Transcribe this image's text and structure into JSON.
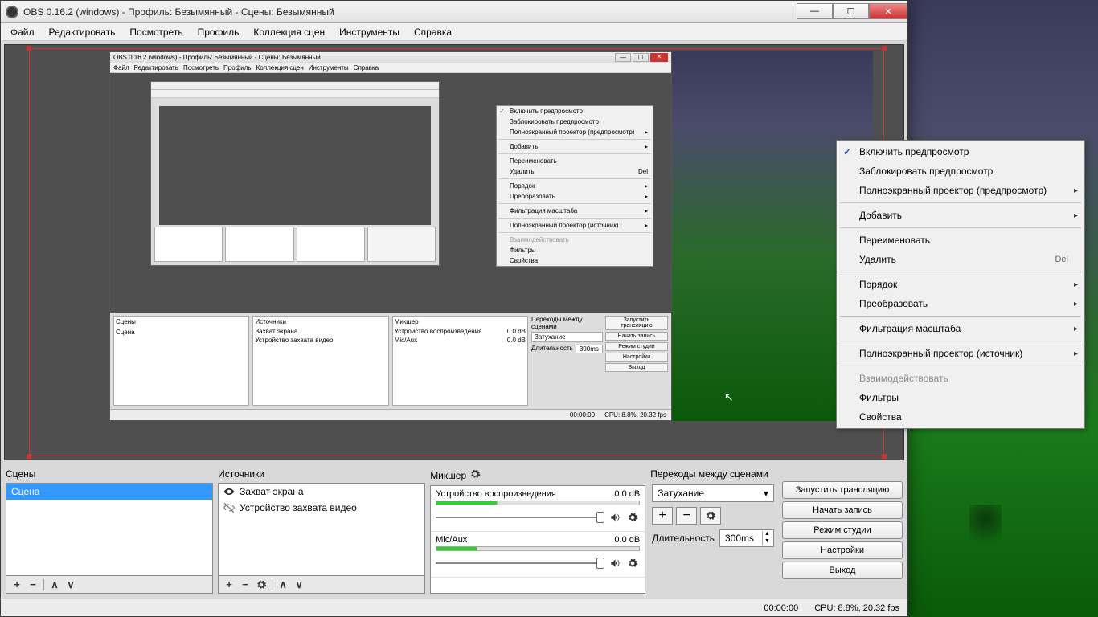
{
  "window": {
    "title": "OBS 0.16.2 (windows) - Профиль: Безымянный - Сцены: Безымянный"
  },
  "menubar": {
    "file": "Файл",
    "edit": "Редактировать",
    "view": "Посмотреть",
    "profile": "Профиль",
    "scene_collection": "Коллекция сцен",
    "tools": "Инструменты",
    "help": "Справка"
  },
  "panels": {
    "scenes": {
      "title": "Сцены"
    },
    "sources": {
      "title": "Источники"
    },
    "mixer": {
      "title": "Микшер"
    },
    "transitions": {
      "title": "Переходы между сценами"
    }
  },
  "scenes": [
    {
      "name": "Сцена",
      "selected": true
    }
  ],
  "sources": [
    {
      "name": "Захват экрана",
      "visible": true,
      "hidden_icon": false
    },
    {
      "name": "Устройство захвата видео",
      "visible": false,
      "hidden_icon": true
    }
  ],
  "mixer": [
    {
      "label": "Устройство воспроизведения",
      "db": "0.0 dB"
    },
    {
      "label": "Mic/Aux",
      "db": "0.0 dB"
    }
  ],
  "transitions": {
    "selected": "Затухание",
    "duration_label": "Длительность",
    "duration_value": "300ms"
  },
  "control_buttons": {
    "start_stream": "Запустить трансляцию",
    "start_record": "Начать запись",
    "studio_mode": "Режим студии",
    "settings": "Настройки",
    "exit": "Выход"
  },
  "statusbar": {
    "time": "00:00:00",
    "stats": "CPU: 8.8%, 20.32 fps"
  },
  "context_menu": {
    "enable_preview": "Включить предпросмотр",
    "lock_preview": "Заблокировать предпросмотр",
    "fullscreen_preview": "Полноэкранный проектор (предпросмотр)",
    "add": "Добавить",
    "rename": "Переименовать",
    "delete": "Удалить",
    "delete_shortcut": "Del",
    "order": "Порядок",
    "transform": "Преобразовать",
    "scale_filtering": "Фильтрация масштаба",
    "fullscreen_source": "Полноэкранный проектор (источник)",
    "interact": "Взаимодействовать",
    "filters": "Фильтры",
    "properties": "Свойства"
  },
  "inner_window": {
    "title": "OBS 0.16.2 (windows) - Профиль: Безымянный - Сцены: Безымянный",
    "panels": {
      "scenes": "Сцены",
      "sources": "Источники",
      "mixer": "Микшер",
      "transitions": "Переходы между сценами"
    },
    "scenes": [
      "Сцена"
    ],
    "sources": [
      "Захват экрана",
      "Устройство захвата видео"
    ],
    "mixer": [
      "Устройство воспроизведения",
      "Mic/Aux"
    ],
    "db": "0.0 dB",
    "transition": "Затухание",
    "duration_label": "Длительность",
    "duration_value": "300ms",
    "buttons": [
      "Запустить трансляцию",
      "Начать запись",
      "Режим студии",
      "Настройки",
      "Выход"
    ],
    "status_time": "00:00:00",
    "status_stats": "CPU: 8.8%, 20.32 fps",
    "ctx": [
      "Включить предпросмотр",
      "Заблокировать предпросмотр",
      "Полноэкранный проектор (предпросмотр)",
      "Добавить",
      "Переименовать",
      "Удалить",
      "Порядок",
      "Преобразовать",
      "Фильтрация масштаба",
      "Полноэкранный проектор (источник)",
      "Взаимодействовать",
      "Фильтры",
      "Свойства"
    ]
  }
}
